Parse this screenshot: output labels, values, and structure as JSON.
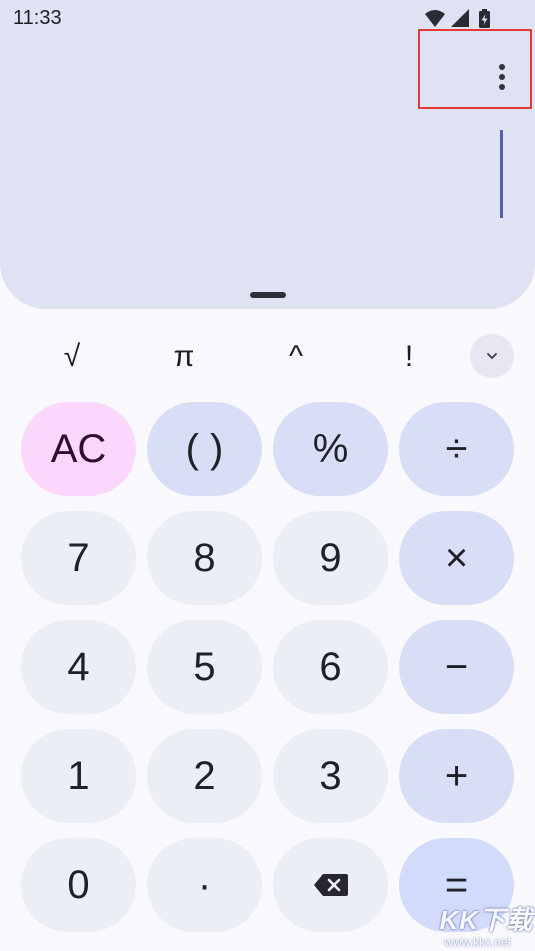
{
  "status_bar": {
    "time": "11:33",
    "icons": [
      "wifi-icon",
      "cell-signal-icon",
      "battery-charging-icon"
    ]
  },
  "display": {
    "expression": "",
    "result": ""
  },
  "toolbar": {
    "menu_icon": "more-vert-icon"
  },
  "scientific_row": {
    "keys": [
      "√",
      "π",
      "^",
      "!"
    ],
    "expand_icon": "chevron-down-icon"
  },
  "keypad": {
    "clear": "AC",
    "parens": "( )",
    "percent": "%",
    "divide": "÷",
    "seven": "7",
    "eight": "8",
    "nine": "9",
    "multiply": "×",
    "four": "4",
    "five": "5",
    "six": "6",
    "subtract": "−",
    "one": "1",
    "two": "2",
    "three": "3",
    "add": "+",
    "zero": "0",
    "decimal": "·",
    "backspace_icon": "backspace-icon",
    "equals": "="
  },
  "watermark": {
    "logo": "KK下载",
    "url": "www.kkx.net"
  },
  "colors": {
    "display_bg": "#dfe2f2",
    "page_bg": "#f8f8fd",
    "number_key": "#eceef6",
    "operator_key": "#d9def7",
    "clear_key": "#fbd8fb",
    "highlight": "#e53935",
    "cursor": "#4d63a8"
  }
}
